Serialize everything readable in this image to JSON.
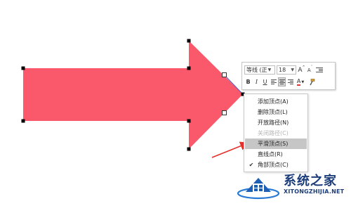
{
  "toolbar": {
    "font_name": "等线 (正",
    "font_size": "18",
    "grow_font": "A",
    "shrink_font": "A",
    "bold": "B",
    "italic": "I",
    "underline": "U",
    "font_color": "A"
  },
  "context_menu": {
    "items": [
      {
        "label": "添加顶点(A)",
        "checked": false,
        "disabled": false,
        "highlighted": false
      },
      {
        "label": "删除顶点(L)",
        "checked": false,
        "disabled": false,
        "highlighted": false
      },
      {
        "label": "开放路径(N)",
        "checked": false,
        "disabled": false,
        "highlighted": false
      },
      {
        "label": "关闭路径(C)",
        "checked": false,
        "disabled": true,
        "highlighted": false
      },
      {
        "label": "平滑顶点(S)",
        "checked": false,
        "disabled": false,
        "highlighted": true
      },
      {
        "label": "直线点(R)",
        "checked": false,
        "disabled": false,
        "highlighted": false
      },
      {
        "label": "角部顶点(C)",
        "checked": true,
        "disabled": false,
        "highlighted": false
      }
    ],
    "check_glyph": "✔"
  },
  "colors": {
    "arrow_fill": "#f9596a",
    "pointer_arrow": "#e5302b",
    "edited_segment": "#4d55c8",
    "watermark": "#1d3e7a"
  },
  "watermark": {
    "title": "系统之家",
    "subtitle": "XITONGZHIJIA.NET"
  }
}
